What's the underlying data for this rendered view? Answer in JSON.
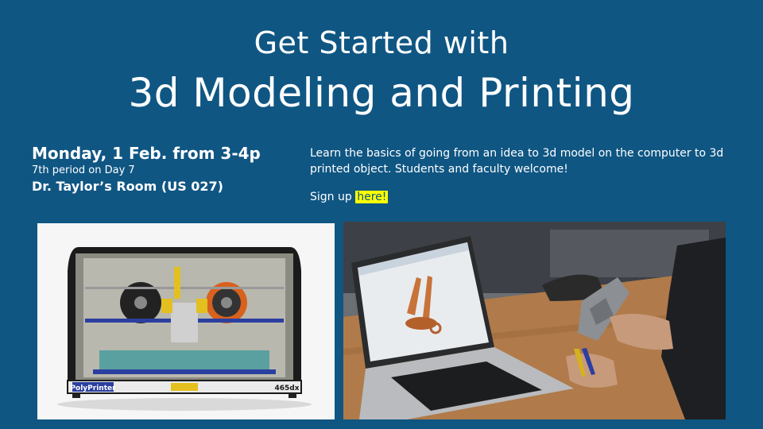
{
  "title": {
    "line1": "Get Started with",
    "line2": "3d Modeling and Printing"
  },
  "event": {
    "date": "Monday, 1 Feb. from 3-4p",
    "period": "7th period on Day 7",
    "room": "Dr. Taylor’s Room (US 027)"
  },
  "description": "Learn the basics of going from an idea to 3d model on the computer to 3d printed object. Students and faculty welcome!",
  "signup": {
    "prefix": "Sign up ",
    "link": "here!"
  },
  "printer_photo": {
    "brand": "PolyPrinter",
    "model": "465dx"
  },
  "colors": {
    "background": "#0f5683",
    "highlight": "#ffff00"
  }
}
